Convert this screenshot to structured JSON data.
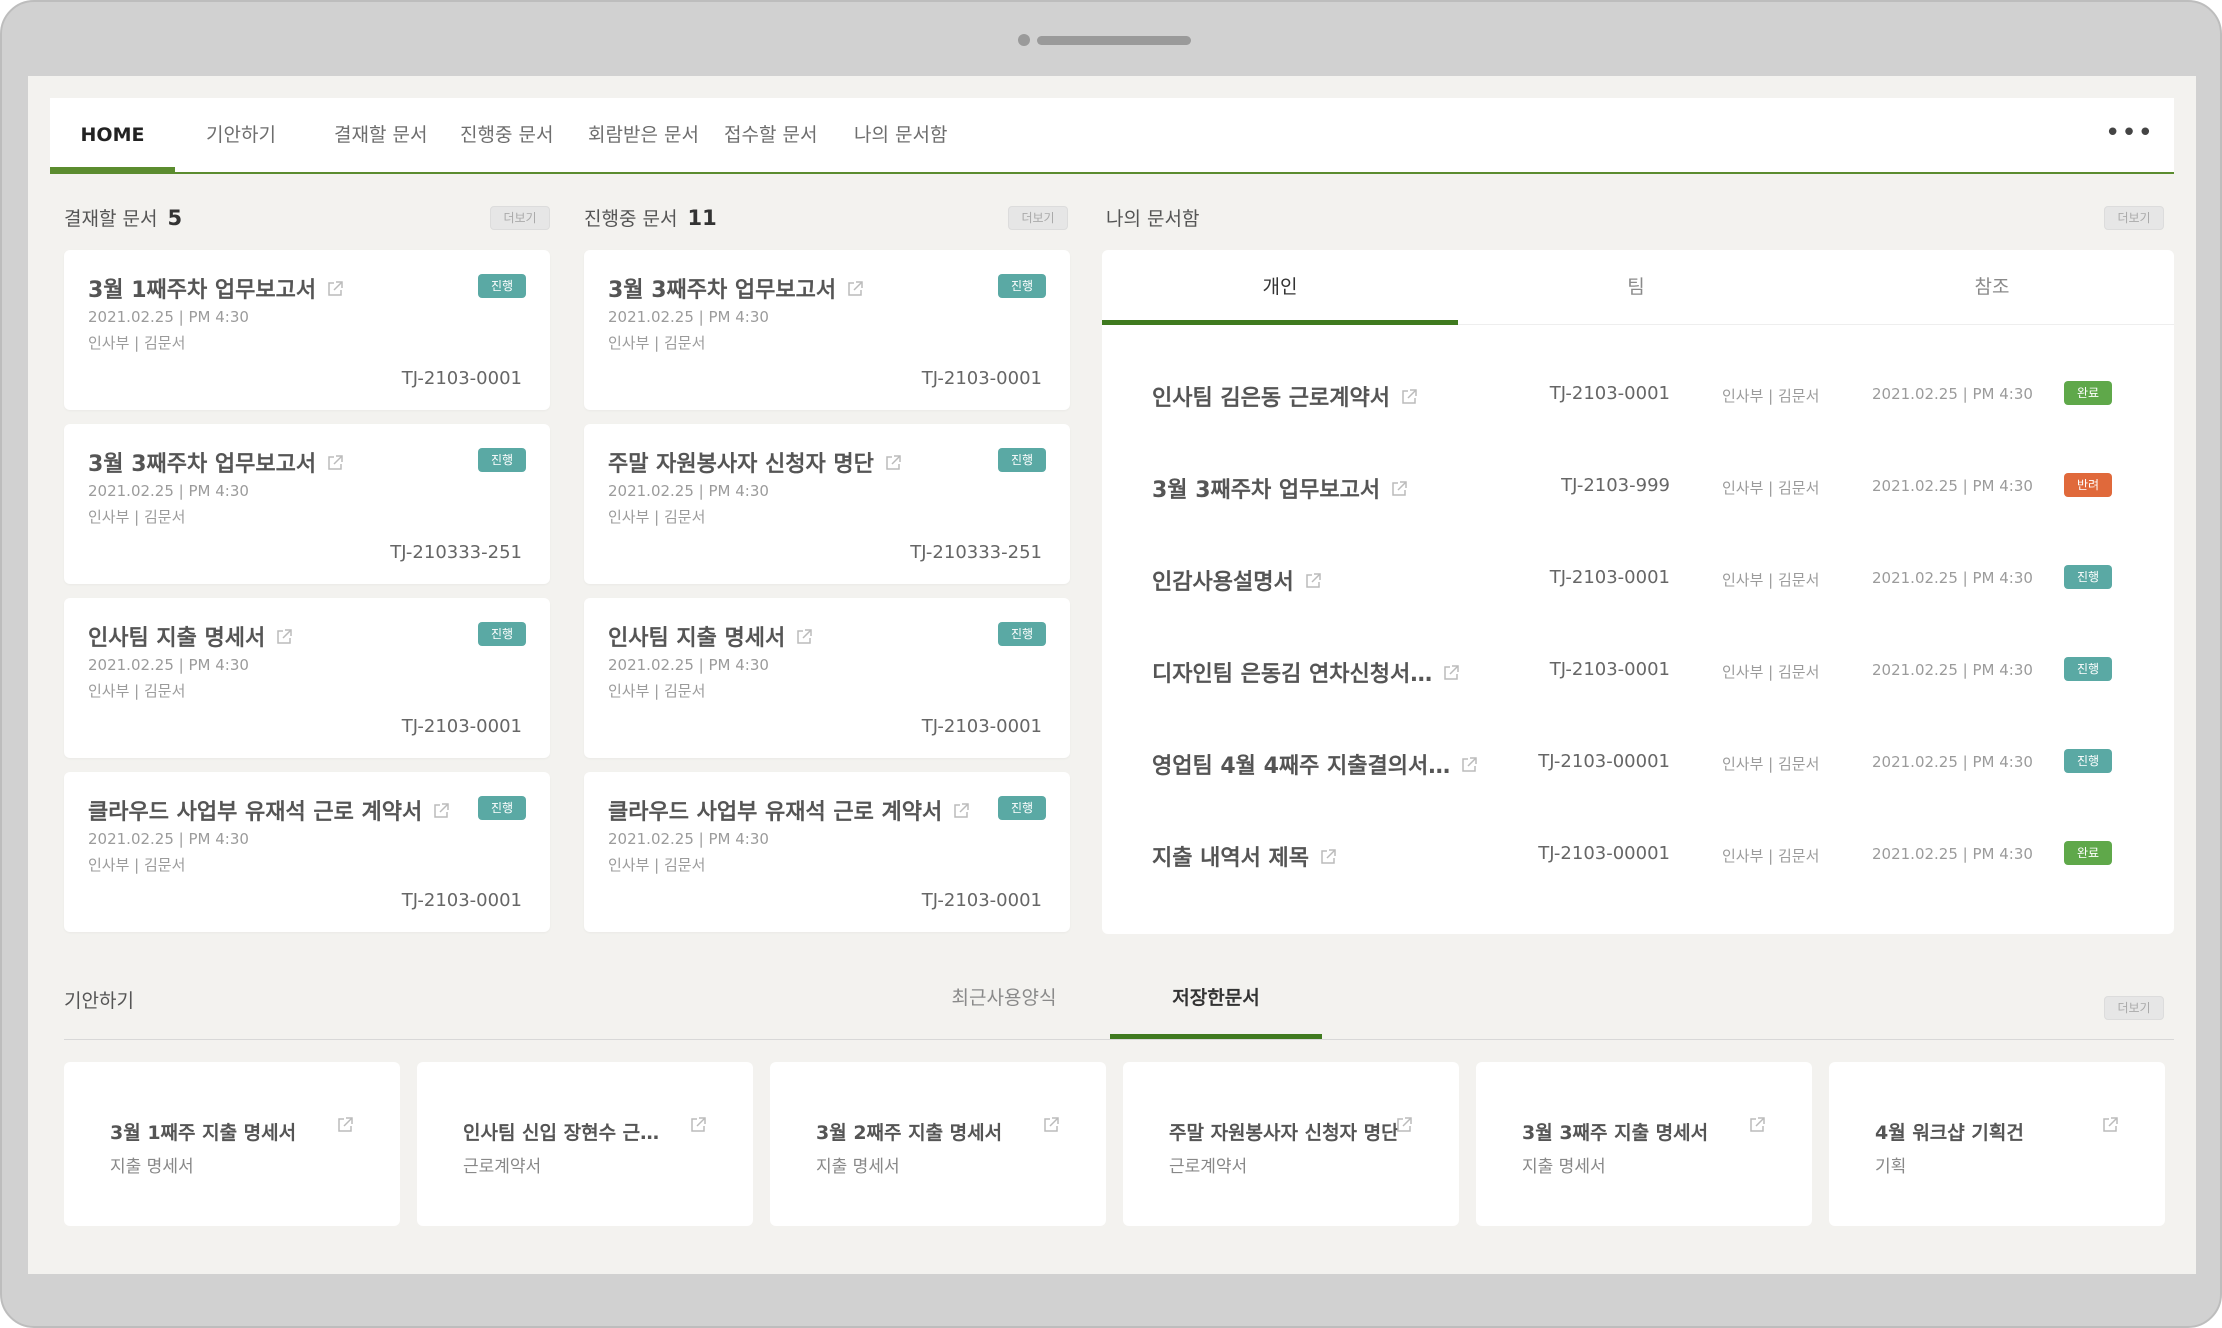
{
  "nav": {
    "items": [
      "HOME",
      "기안하기",
      "결재할 문서",
      "진행중 문서",
      "회람받은 문서",
      "접수할 문서",
      "나의 문서함"
    ],
    "more": "•••"
  },
  "approve": {
    "title": "결재할 문서",
    "count": "5",
    "more": "더보기",
    "cards": [
      {
        "title": "3월 1째주차 업무보고서",
        "badge": "진행",
        "date": "2021.02.25  |  PM 4:30",
        "dept": "인사부  |  김문서",
        "code": "TJ-2103-0001"
      },
      {
        "title": "3월 3째주차 업무보고서",
        "badge": "진행",
        "date": "2021.02.25  |  PM 4:30",
        "dept": "인사부  |  김문서",
        "code": "TJ-210333-251"
      },
      {
        "title": "인사팀 지출 명세서",
        "badge": "진행",
        "date": "2021.02.25  |  PM 4:30",
        "dept": "인사부  |  김문서",
        "code": "TJ-2103-0001"
      },
      {
        "title": "클라우드 사업부 유재석 근로 계약서",
        "badge": "진행",
        "date": "2021.02.25  |  PM 4:30",
        "dept": "인사부  |  김문서",
        "code": "TJ-2103-0001"
      }
    ]
  },
  "progress": {
    "title": "진행중 문서",
    "count": "11",
    "more": "더보기",
    "cards": [
      {
        "title": "3월 3째주차 업무보고서",
        "badge": "진행",
        "date": "2021.02.25  |  PM 4:30",
        "dept": "인사부  |  김문서",
        "code": "TJ-2103-0001"
      },
      {
        "title": "주말 자원봉사자 신청자 명단",
        "badge": "진행",
        "date": "2021.02.25  |  PM 4:30",
        "dept": "인사부  |  김문서",
        "code": "TJ-210333-251"
      },
      {
        "title": "인사팀 지출 명세서",
        "badge": "진행",
        "date": "2021.02.25  |  PM 4:30",
        "dept": "인사부  |  김문서",
        "code": "TJ-2103-0001"
      },
      {
        "title": "클라우드 사업부 유재석 근로 계약서",
        "badge": "진행",
        "date": "2021.02.25  |  PM 4:30",
        "dept": "인사부  |  김문서",
        "code": "TJ-2103-0001"
      }
    ]
  },
  "mydocs": {
    "title": "나의 문서함",
    "more": "더보기",
    "tabs": [
      "개인",
      "팀",
      "참조"
    ],
    "rows": [
      {
        "title": "인사팀 김은동 근로계약서",
        "code": "TJ-2103-0001",
        "dept": "인사부  |  김문서",
        "date": "2021.02.25  |  PM 4:30",
        "badge": "완료",
        "status": "done"
      },
      {
        "title": "3월 3째주차 업무보고서",
        "code": "TJ-2103-999",
        "dept": "인사부  |  김문서",
        "date": "2021.02.25  |  PM 4:30",
        "badge": "반려",
        "status": "returned"
      },
      {
        "title": "인감사용설명서",
        "code": "TJ-2103-0001",
        "dept": "인사부  |  김문서",
        "date": "2021.02.25  |  PM 4:30",
        "badge": "진행",
        "status": "progress"
      },
      {
        "title": "디자인팀 은동김 연차신청서…",
        "code": "TJ-2103-0001",
        "dept": "인사부  |  김문서",
        "date": "2021.02.25  |  PM 4:30",
        "badge": "진행",
        "status": "progress"
      },
      {
        "title": "영업팀 4월 4째주 지출결의서…",
        "code": "TJ-2103-00001",
        "dept": "인사부  |  김문서",
        "date": "2021.02.25  |  PM 4:30",
        "badge": "진행",
        "status": "progress"
      },
      {
        "title": "지출 내역서 제목",
        "code": "TJ-2103-00001",
        "dept": "인사부  |  김문서",
        "date": "2021.02.25  |  PM 4:30",
        "badge": "완료",
        "status": "done"
      }
    ]
  },
  "draft": {
    "title": "기안하기",
    "tabs": [
      "최근사용양식",
      "저장한문서"
    ],
    "more": "더보기",
    "cards": [
      {
        "title": "3월 1째주 지출 명세서",
        "type": "지출 명세서"
      },
      {
        "title": "인사팀 신입 장현수 근…",
        "type": "근로계약서"
      },
      {
        "title": "3월 2째주 지출 명세서",
        "type": "지출 명세서"
      },
      {
        "title": "주말 자원봉사자 신청자 명단",
        "type": "근로계약서"
      },
      {
        "title": "3월 3째주 지출 명세서",
        "type": "지출 명세서"
      },
      {
        "title": "4월 워크샵 기획건",
        "type": "기획"
      }
    ]
  },
  "colors": {
    "accent": "#5b8c2f",
    "progress": "#5aa9a4",
    "done": "#5fa84a",
    "returned": "#e0693b"
  },
  "icons": {
    "external": "external-link-icon",
    "more": "more-dots-icon"
  }
}
